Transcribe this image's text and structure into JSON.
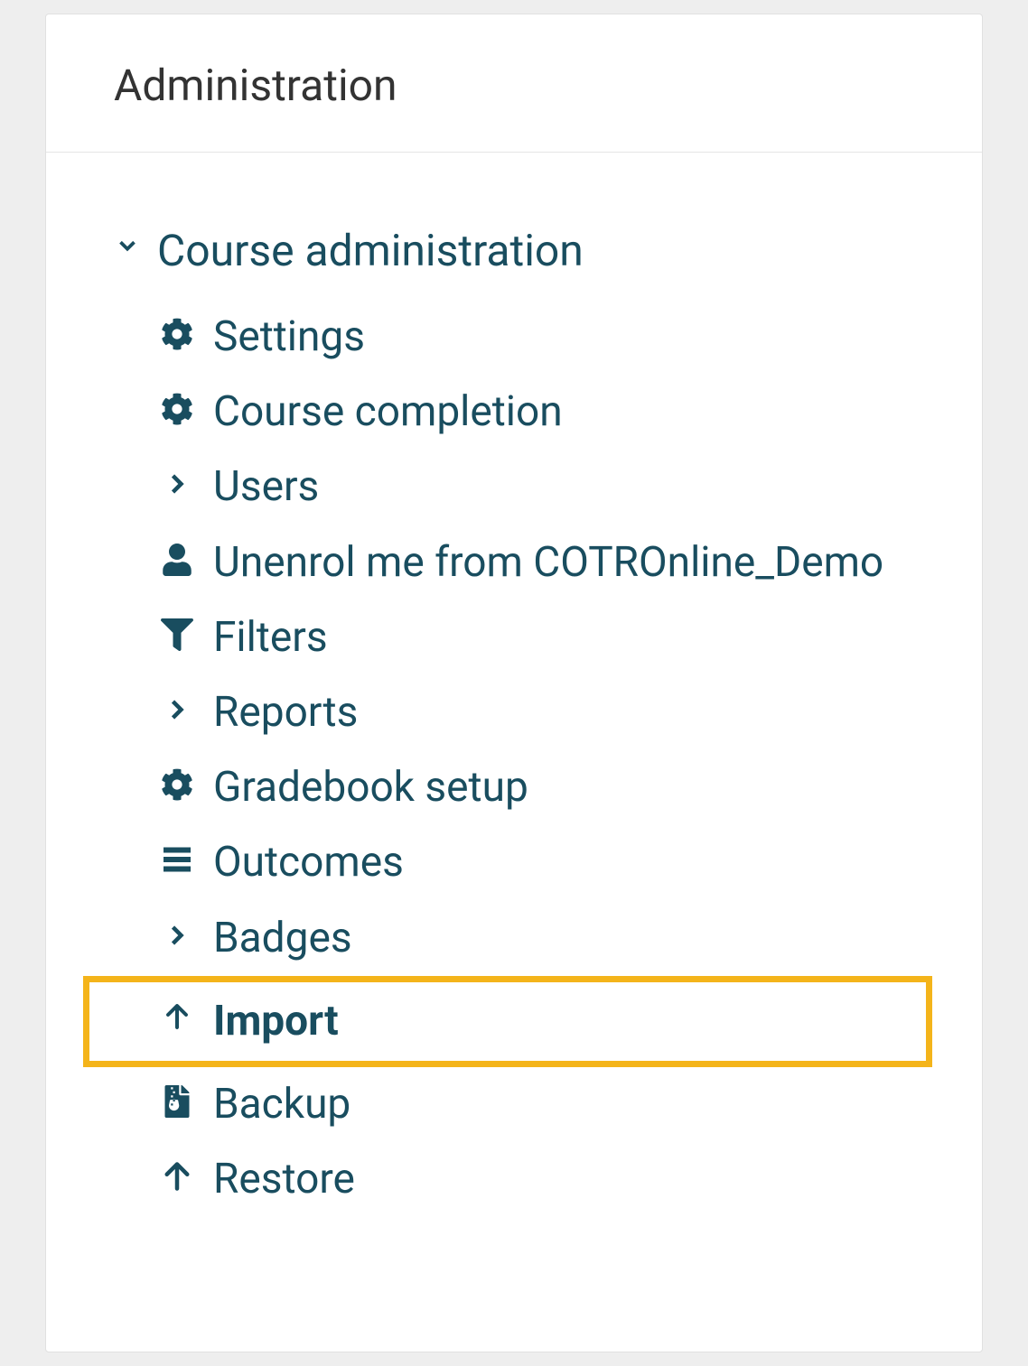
{
  "block": {
    "title": "Administration"
  },
  "tree": {
    "root_label": "Course administration",
    "items": [
      {
        "label": "Settings"
      },
      {
        "label": "Course completion"
      },
      {
        "label": "Users"
      },
      {
        "label": "Unenrol me from COTROnline_Demo"
      },
      {
        "label": "Filters"
      },
      {
        "label": "Reports"
      },
      {
        "label": "Gradebook setup"
      },
      {
        "label": "Outcomes"
      },
      {
        "label": "Badges"
      },
      {
        "label": "Import"
      },
      {
        "label": "Backup"
      },
      {
        "label": "Restore"
      }
    ]
  },
  "highlight_color": "#f4b41a",
  "link_color": "#194d5f"
}
